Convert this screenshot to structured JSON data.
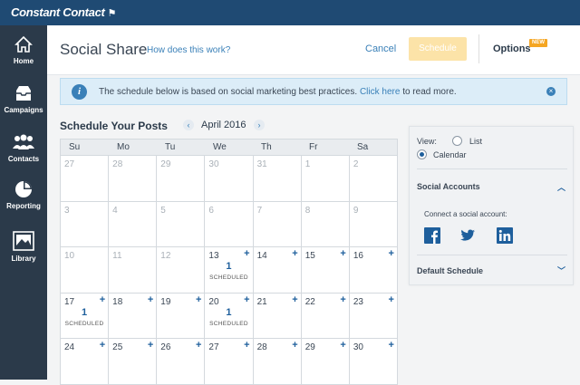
{
  "app": {
    "logo": "Constant Contact"
  },
  "sidebar": {
    "items": [
      {
        "label": "Home",
        "icon": "home-icon"
      },
      {
        "label": "Campaigns",
        "icon": "inbox-icon"
      },
      {
        "label": "Contacts",
        "icon": "people-icon"
      },
      {
        "label": "Reporting",
        "icon": "pie-chart-icon"
      },
      {
        "label": "Library",
        "icon": "image-library-icon"
      }
    ]
  },
  "header": {
    "title": "Social Share",
    "how_link": "How does this work?",
    "cancel_label": "Cancel",
    "schedule_label": "Schedule",
    "options_label": "Options",
    "new_badge": "NEW"
  },
  "banner": {
    "text_before": "The schedule below is based on social marketing best practices.",
    "link": "Click here",
    "text_after": "to read more."
  },
  "schedule": {
    "title": "Schedule Your Posts",
    "month": "April 2016",
    "prev": "‹",
    "next": "›"
  },
  "calendar": {
    "days_of_week": [
      "Su",
      "Mo",
      "Tu",
      "We",
      "Th",
      "Fr",
      "Sa"
    ],
    "weeks": [
      [
        {
          "n": "27",
          "dim": true
        },
        {
          "n": "28",
          "dim": true
        },
        {
          "n": "29",
          "dim": true
        },
        {
          "n": "30",
          "dim": true
        },
        {
          "n": "31",
          "dim": true
        },
        {
          "n": "1",
          "dim": true
        },
        {
          "n": "2",
          "dim": true
        }
      ],
      [
        {
          "n": "3",
          "dim": true
        },
        {
          "n": "4",
          "dim": true
        },
        {
          "n": "5",
          "dim": true
        },
        {
          "n": "6",
          "dim": true
        },
        {
          "n": "7",
          "dim": true
        },
        {
          "n": "8",
          "dim": true
        },
        {
          "n": "9",
          "dim": true
        }
      ],
      [
        {
          "n": "10",
          "dim": true
        },
        {
          "n": "11",
          "dim": true
        },
        {
          "n": "12",
          "dim": true
        },
        {
          "n": "13",
          "plus": true,
          "count": "1",
          "tag": "SCHEDULED"
        },
        {
          "n": "14",
          "plus": true
        },
        {
          "n": "15",
          "plus": true
        },
        {
          "n": "16",
          "plus": true
        }
      ],
      [
        {
          "n": "17",
          "plus": true,
          "count": "1",
          "tag": "SCHEDULED"
        },
        {
          "n": "18",
          "plus": true
        },
        {
          "n": "19",
          "plus": true
        },
        {
          "n": "20",
          "plus": true,
          "count": "1",
          "tag": "SCHEDULED"
        },
        {
          "n": "21",
          "plus": true
        },
        {
          "n": "22",
          "plus": true
        },
        {
          "n": "23",
          "plus": true
        }
      ],
      [
        {
          "n": "24",
          "plus": true
        },
        {
          "n": "25",
          "plus": true
        },
        {
          "n": "26",
          "plus": true
        },
        {
          "n": "27",
          "plus": true
        },
        {
          "n": "28",
          "plus": true
        },
        {
          "n": "29",
          "plus": true
        },
        {
          "n": "30",
          "plus": true
        }
      ]
    ]
  },
  "panel": {
    "view_label": "View:",
    "list_label": "List",
    "calendar_label": "Calendar",
    "selected": "Calendar",
    "social_accounts": "Social Accounts",
    "connect_text": "Connect a social account:",
    "default_schedule": "Default Schedule",
    "networks": [
      "facebook-icon",
      "twitter-icon",
      "linkedin-icon"
    ]
  },
  "colors": {
    "topbar": "#1f4a73",
    "sidebar": "#2b3a4a",
    "accent": "#1e5f9c",
    "schedule_button": "#fce3a8",
    "badge": "#f5a623"
  }
}
